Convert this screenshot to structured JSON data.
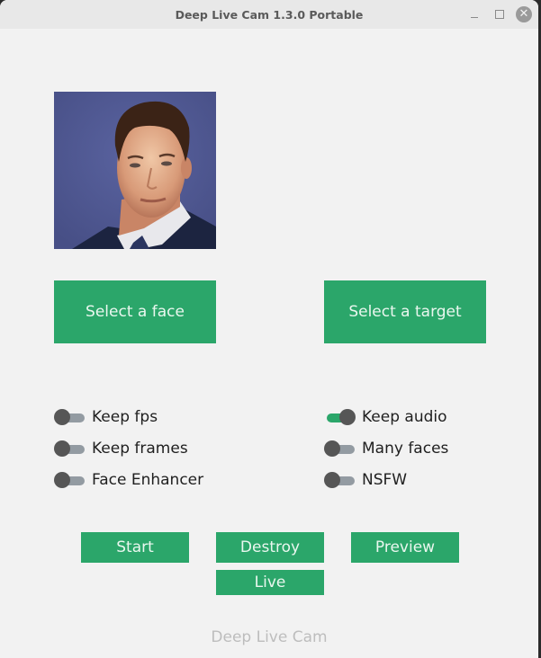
{
  "window": {
    "title": "Deep Live Cam 1.3.0 Portable",
    "controls": {
      "minimize_icon": "minimize-icon",
      "maximize_icon": "maximize-icon",
      "close_icon": "close-icon",
      "close_glyph": "✕"
    }
  },
  "source_image": {
    "alt": "Selected source face photo",
    "description": "Portrait of a man in dark suit and white shirt against blue background"
  },
  "buttons": {
    "select_face": "Select a face",
    "select_target": "Select a target",
    "start": "Start",
    "destroy": "Destroy",
    "preview": "Preview",
    "live": "Live"
  },
  "switches": {
    "left": [
      {
        "label": "Keep fps",
        "on": false
      },
      {
        "label": "Keep frames",
        "on": false
      },
      {
        "label": "Face Enhancer",
        "on": false
      }
    ],
    "right": [
      {
        "label": "Keep audio",
        "on": true
      },
      {
        "label": "Many faces",
        "on": false
      },
      {
        "label": "NSFW",
        "on": false
      }
    ]
  },
  "footer": {
    "text": "Deep Live Cam"
  },
  "colors": {
    "accent": "#2ba66a",
    "switch_off_track": "#939ba2",
    "switch_knob": "#565656",
    "background": "#f2f2f2",
    "footer_text": "#bdbdbd"
  }
}
